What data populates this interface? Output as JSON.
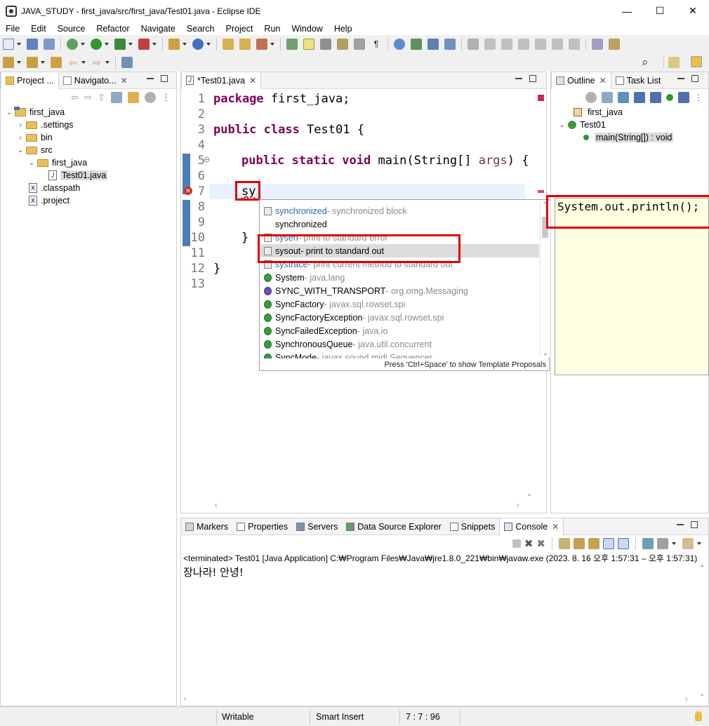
{
  "window": {
    "title": "JAVA_STUDY - first_java/src/first_java/Test01.java - Eclipse IDE",
    "minimize": "—",
    "maximize": "☐",
    "close": "✕"
  },
  "menu": [
    "File",
    "Edit",
    "Source",
    "Refactor",
    "Navigate",
    "Search",
    "Project",
    "Run",
    "Window",
    "Help"
  ],
  "left_panel": {
    "tabs": [
      "Project ...",
      "Navigato..."
    ],
    "tree": [
      {
        "label": "first_java",
        "depth": 0,
        "kind": "project",
        "expanded": true
      },
      {
        "label": ".settings",
        "depth": 1,
        "kind": "folder",
        "expanded": false
      },
      {
        "label": "bin",
        "depth": 1,
        "kind": "folder",
        "expanded": false
      },
      {
        "label": "src",
        "depth": 1,
        "kind": "folder",
        "expanded": true
      },
      {
        "label": "first_java",
        "depth": 2,
        "kind": "folder",
        "expanded": true
      },
      {
        "label": "Test01.java",
        "depth": 3,
        "kind": "java",
        "selected": true
      },
      {
        "label": ".classpath",
        "depth": 1,
        "kind": "xml"
      },
      {
        "label": ".project",
        "depth": 1,
        "kind": "xml"
      }
    ]
  },
  "editor": {
    "tab_label": "*Test01.java",
    "line_numbers": [
      "1",
      "2",
      "3",
      "4",
      "5",
      "6",
      "7",
      "8",
      "9",
      "10",
      "11",
      "12",
      "13"
    ],
    "lines": {
      "l1_kw": "package",
      "l1_rest": " first_java;",
      "l3_kw": "public class",
      "l3_rest": " Test01 {",
      "l5_kw": "public static void",
      "l5_rest": " main(String[] ",
      "l5_param": "args",
      "l5_end": ") {",
      "l7_text": "sy",
      "l10_text": "}",
      "l12_text": "}"
    }
  },
  "autocomplete": {
    "proposals": [
      {
        "name": "synchronized",
        "desc": " - synchronized block",
        "icon": "template",
        "hl": true
      },
      {
        "name": "synchronized",
        "desc": "",
        "icon": "none"
      },
      {
        "name": "sysen",
        "desc": " - print to standard error",
        "icon": "template",
        "hl": true
      },
      {
        "name": "sysout",
        "desc": " - print to standard out",
        "icon": "template",
        "selected": true
      },
      {
        "name": "systrace",
        "desc": " - print current method to standard out",
        "icon": "template",
        "hl": true
      },
      {
        "name": "System",
        "desc": " - java.lang",
        "icon": "class"
      },
      {
        "name": "SYNC_WITH_TRANSPORT",
        "desc": " - org.omg.Messaging",
        "icon": "interface"
      },
      {
        "name": "SyncFactory",
        "desc": " - javax.sql.rowset.spi",
        "icon": "class"
      },
      {
        "name": "SyncFactoryException",
        "desc": " - javax.sql.rowset.spi",
        "icon": "class"
      },
      {
        "name": "SyncFailedException",
        "desc": " - java.io",
        "icon": "class"
      },
      {
        "name": "SynchronousQueue",
        "desc": " - java.util.concurrent",
        "icon": "class"
      },
      {
        "name": "SyncMode",
        "desc": " - javax.sound.midi.Sequencer",
        "icon": "class"
      }
    ],
    "footer": "Press 'Ctrl+Space' to show Template Proposals",
    "preview": "System.out.println();"
  },
  "right_panel": {
    "tabs": [
      "Outline",
      "Task List"
    ],
    "outline": [
      {
        "label": "first_java",
        "kind": "package"
      },
      {
        "label": "Test01",
        "kind": "class"
      },
      {
        "label": "main(String[]) : void",
        "kind": "method"
      }
    ]
  },
  "bottom_panel": {
    "tabs": [
      "Markers",
      "Properties",
      "Servers",
      "Data Source Explorer",
      "Snippets",
      "Console"
    ],
    "console_header": "<terminated> Test01 [Java Application] C:₩Program Files₩Java₩jre1.8.0_221₩bin₩javaw.exe  (2023. 8. 16 오후 1:57:31 – 오후 1:57:31)",
    "console_output": "장나라! 안녕!"
  },
  "status_bar": {
    "writable": "Writable",
    "insert_mode": "Smart Insert",
    "position": "7 : 7 : 96"
  },
  "colors": {
    "keyword": "#7f0055",
    "highlight_red": "#e00000",
    "selection": "#dcdcdc"
  }
}
